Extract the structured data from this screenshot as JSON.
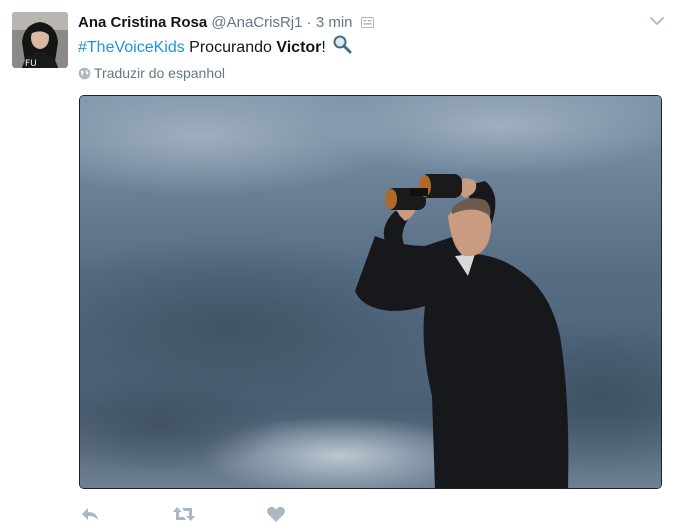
{
  "tweet": {
    "author_name": "Ana Cristina Rosa",
    "handle": "@AnaCrisRj1",
    "separator": "·",
    "time": "3 min",
    "text": {
      "hashtag": "#TheVoiceKids",
      "middle": " Procurando ",
      "bold": "Victor",
      "end": "!"
    },
    "translate_label": "Traduzir do espanhol"
  },
  "icons": {
    "caret": "chevron-down-icon",
    "globe": "globe-icon",
    "magnifier": "magnifying-glass-emoji",
    "reply": "reply-icon",
    "retweet": "retweet-icon",
    "like": "heart-icon",
    "cc": "caption-icon"
  },
  "colors": {
    "link": "#1b95e0",
    "muted": "#657786",
    "icon": "#aab8c2",
    "text": "#14171a"
  }
}
